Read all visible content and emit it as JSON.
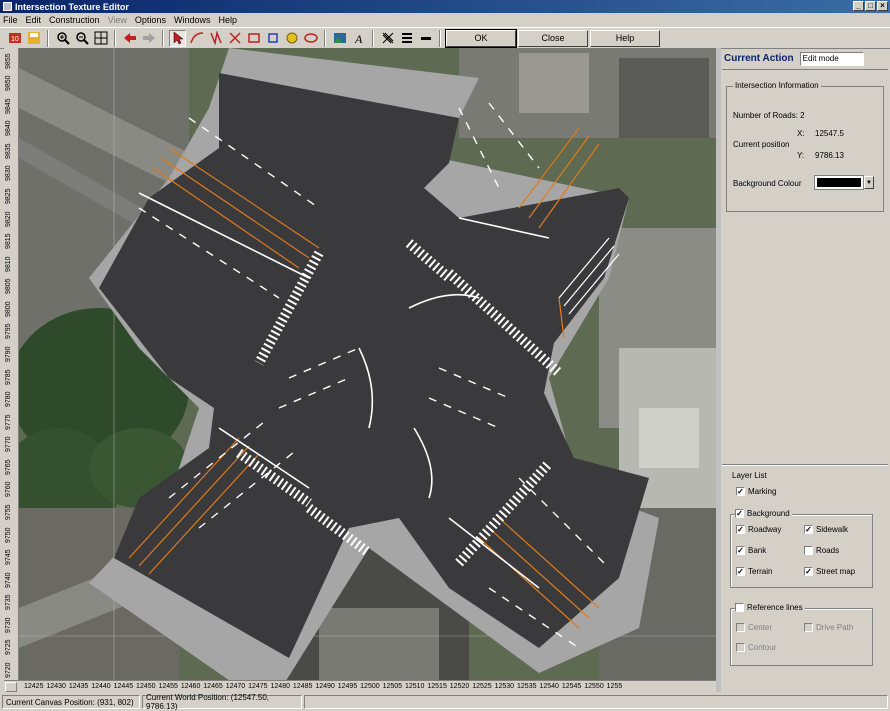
{
  "window": {
    "title": "Intersection Texture Editor",
    "title_buttons": [
      "_",
      "□",
      "×"
    ]
  },
  "menu": [
    {
      "label": "File",
      "enabled": true
    },
    {
      "label": "Edit",
      "enabled": true
    },
    {
      "label": "Construction",
      "enabled": true
    },
    {
      "label": "View",
      "enabled": false
    },
    {
      "label": "Options",
      "enabled": true
    },
    {
      "label": "Windows",
      "enabled": true
    },
    {
      "label": "Help",
      "enabled": true
    }
  ],
  "toolbar": {
    "ok_label": "OK",
    "close_label": "Close",
    "help_label": "Help"
  },
  "right_panel": {
    "current_action_label": "Current Action",
    "current_action_value": "Edit mode",
    "info_title": "Intersection Information",
    "roads_label": "Number of Roads: 2",
    "position_label": "Current position",
    "x_label": "X:",
    "x_value": "12547.5",
    "y_label": "Y:",
    "y_value": "9786.13",
    "bg_colour_label": "Background Colour",
    "bg_colour": "#000000",
    "layer_list_title": "Layer List",
    "layers": {
      "marking": {
        "label": "Marking",
        "checked": true
      },
      "background": {
        "label": "Background",
        "checked": true
      },
      "roadway": {
        "label": "Roadway",
        "checked": true
      },
      "sidewalk": {
        "label": "Sidewalk",
        "checked": true
      },
      "bank": {
        "label": "Bank",
        "checked": true
      },
      "roads": {
        "label": "Roads",
        "checked": false
      },
      "terrain": {
        "label": "Terrain",
        "checked": true
      },
      "street_map": {
        "label": "Street map",
        "checked": true
      },
      "reference_lines": {
        "label": "Reference lines",
        "checked": false
      },
      "center": {
        "label": "Center",
        "checked": false
      },
      "drive_path": {
        "label": "Drive Path",
        "checked": false
      },
      "contour": {
        "label": "Contour",
        "checked": false
      }
    }
  },
  "rulers": {
    "horizontal": [
      "12425",
      "12430",
      "12435",
      "12440",
      "12445",
      "12450",
      "12455",
      "12460",
      "12465",
      "12470",
      "12475",
      "12480",
      "12485",
      "12490",
      "12495",
      "12500",
      "12505",
      "12510",
      "12515",
      "12520",
      "12525",
      "12530",
      "12535",
      "12540",
      "12545",
      "12550",
      "1255"
    ],
    "vertical": [
      "9855",
      "9850",
      "9845",
      "9840",
      "9835",
      "9830",
      "9825",
      "9820",
      "9815",
      "9810",
      "9805",
      "9800",
      "9795",
      "9790",
      "9785",
      "9780",
      "9775",
      "9770",
      "9765",
      "9760",
      "9755",
      "9750",
      "9745",
      "9740",
      "9735",
      "9730",
      "9725",
      "9720"
    ]
  },
  "status": {
    "canvas_position": "Current Canvas Position: (931, 802)",
    "world_position": "Current World Position: (12547.50, 9786.13)"
  },
  "colors": {
    "road": "#3a3a3c",
    "sidewalk": "#a6a6a6",
    "lane_line": "#ffffff",
    "center_line": "#e07a1a",
    "title_bar": "#0a246a"
  }
}
